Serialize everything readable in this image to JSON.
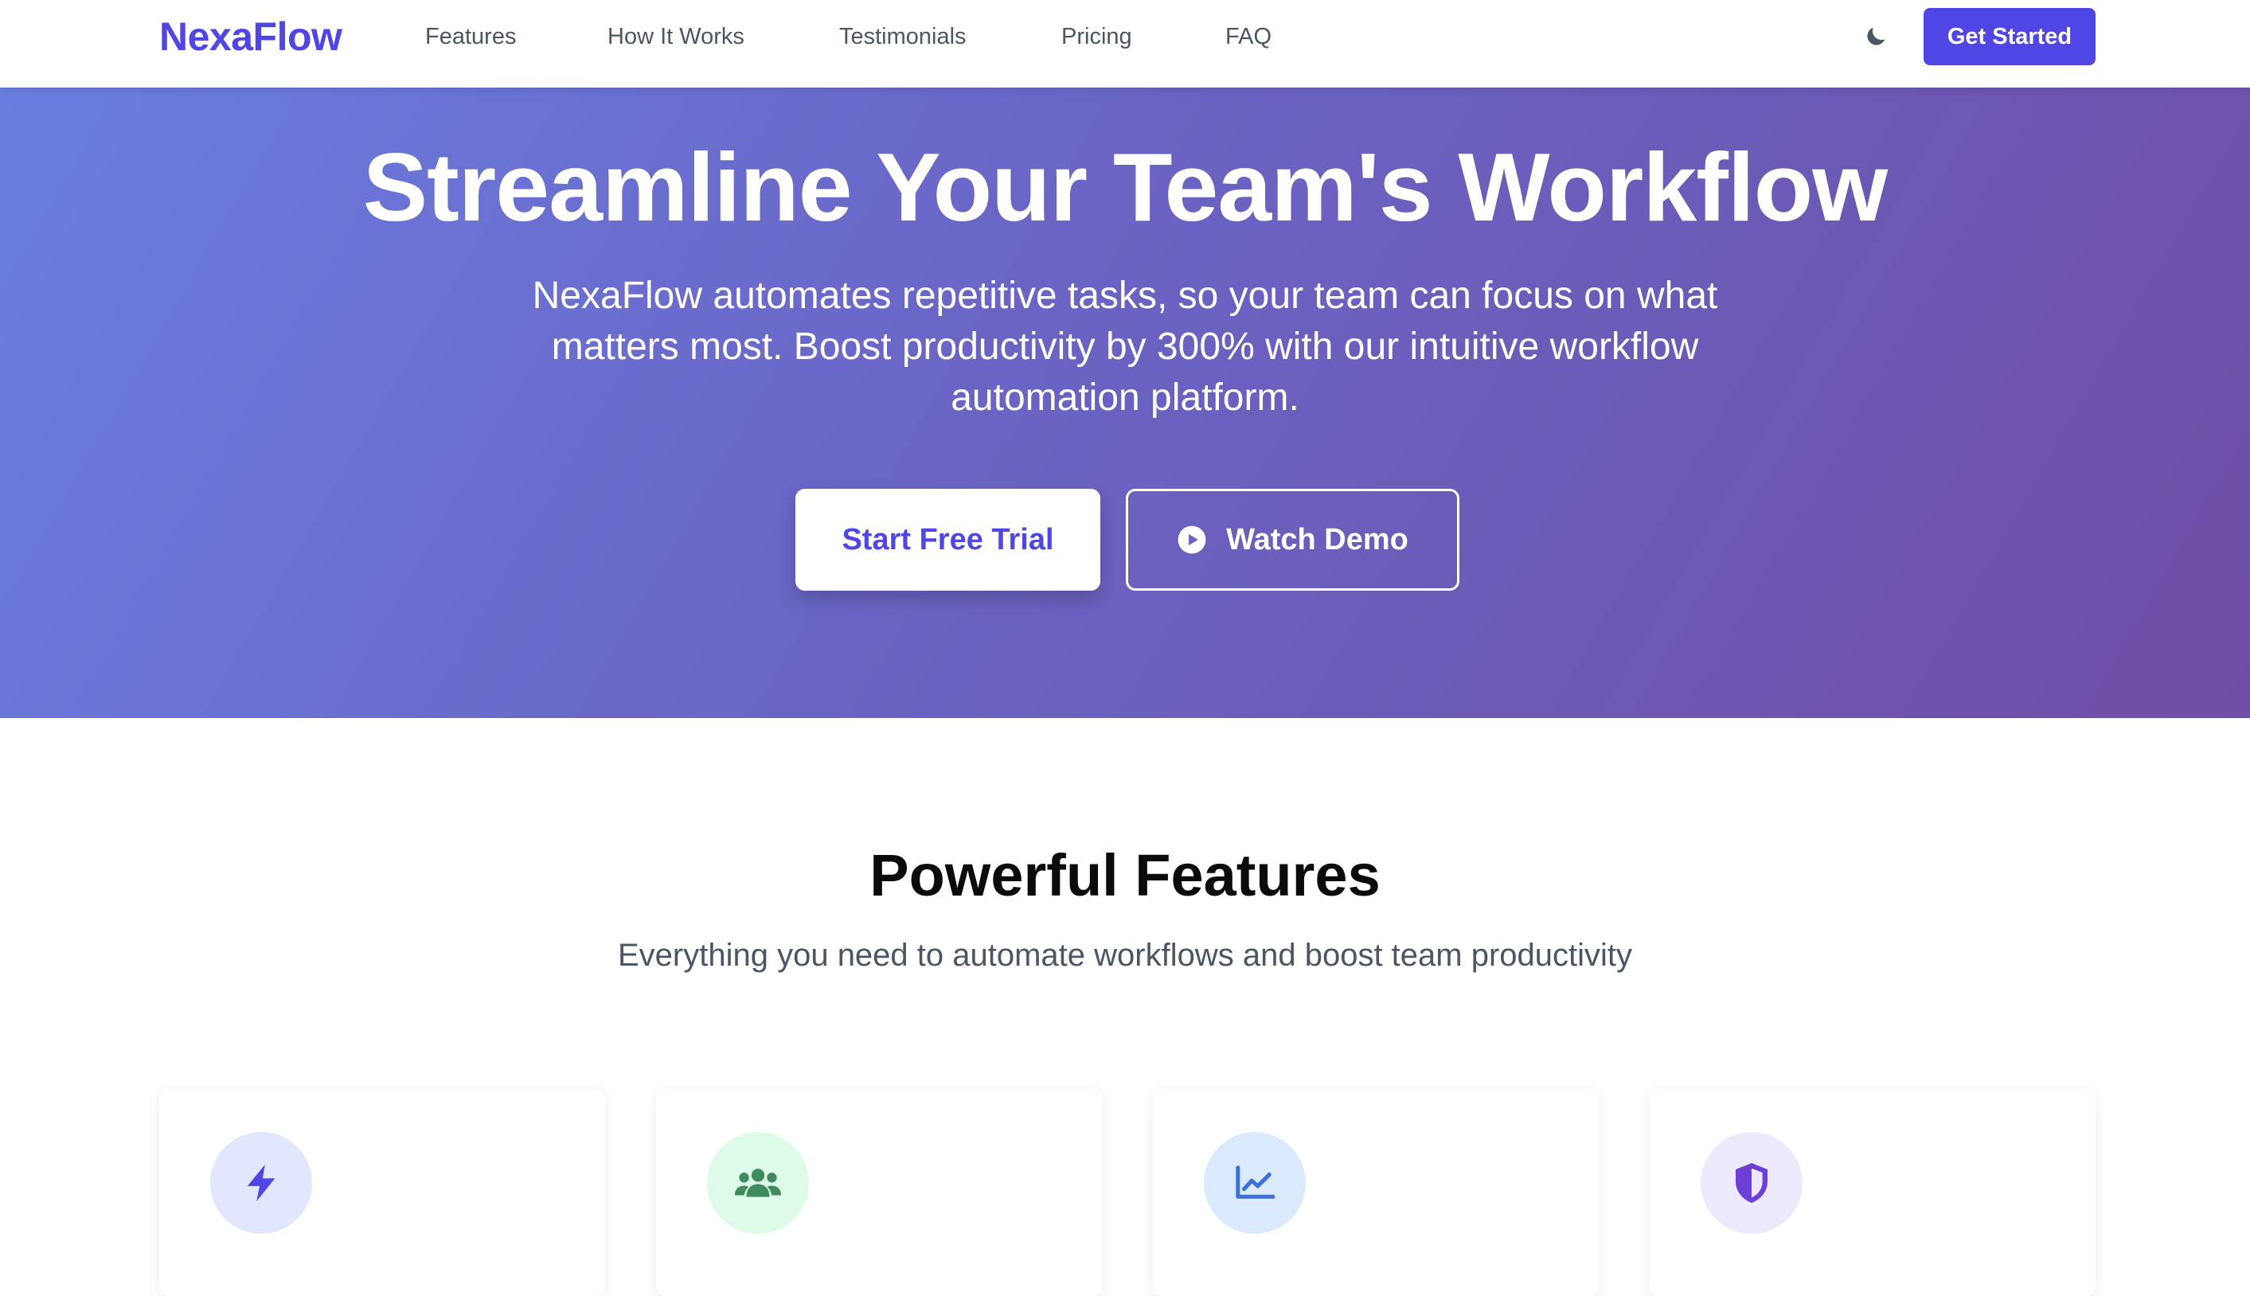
{
  "header": {
    "logo": "NexaFlow",
    "nav": [
      {
        "label": "Features"
      },
      {
        "label": "How It Works"
      },
      {
        "label": "Testimonials"
      },
      {
        "label": "Pricing"
      },
      {
        "label": "FAQ"
      }
    ],
    "theme_icon": "moon-icon",
    "cta_label": "Get Started"
  },
  "hero": {
    "title": "Streamline Your Team's Workflow",
    "subtitle": "NexaFlow automates repetitive tasks, so your team can focus on what matters most. Boost productivity by 300% with our intuitive workflow automation platform.",
    "primary_button": "Start Free Trial",
    "secondary_button": "Watch Demo",
    "secondary_icon": "play-circle-icon"
  },
  "features": {
    "title": "Powerful Features",
    "subtitle": "Everything you need to automate workflows and boost team productivity",
    "cards": [
      {
        "icon": "lightning-bolt-icon",
        "icon_bg": "#e0e7ff",
        "icon_color": "#4f46e5"
      },
      {
        "icon": "users-icon",
        "icon_bg": "#dcfce7",
        "icon_color": "#3f8a5e"
      },
      {
        "icon": "line-chart-icon",
        "icon_bg": "#dbeafe",
        "icon_color": "#3b6fd9"
      },
      {
        "icon": "shield-icon",
        "icon_bg": "#ede9fe",
        "icon_color": "#6d3fd6"
      }
    ]
  },
  "colors": {
    "brand": "#4f46e5",
    "hero_gradient_start": "#6a7ee0",
    "hero_gradient_end": "#6f4ea6"
  }
}
